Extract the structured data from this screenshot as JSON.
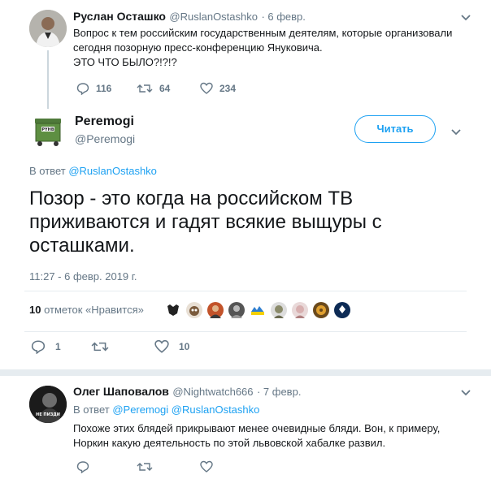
{
  "tweet1": {
    "author_name": "Руслан Осташко",
    "author_handle": "@RuslanOstashko",
    "date": "· 6 февр.",
    "text_line1": "Вопрос к тем российским государственным деятелям, которые организовали",
    "text_line2": "сегодня позорную пресс-конференцию Януковича.",
    "text_line3": "ЭТО ЧТО БЫЛО?!?!?",
    "replies": "116",
    "retweets": "64",
    "likes": "234"
  },
  "main_tweet": {
    "author_name": "Peremogi",
    "author_handle": "@Peremogi",
    "follow_label": "Читать",
    "reply_prefix": "В ответ",
    "reply_to": "@RuslanOstashko",
    "text": "Позор - это когда на российском ТВ приживаются и гадят всякие выщуры с осташками.",
    "timestamp": "11:27 - 6 февр. 2019 г.",
    "likes_count": "10",
    "likes_label": "отметок «Нравится»",
    "replies": "1",
    "retweets": "",
    "likes": "10",
    "avatar_label": "РУНВ"
  },
  "tweet3": {
    "author_name": "Олег Шаповалов",
    "author_handle": "@Nightwatch666",
    "date": "· 7 февр.",
    "reply_prefix": "В ответ",
    "reply_to_1": "@Peremogi",
    "reply_to_2": "@RuslanOstashko",
    "text_line1": "Похоже этих блядей прикрывают менее очевидные бляди. Вон, к примеру,",
    "text_line2": "Норкин какую деятельность по этой львовской хабалке развил.",
    "avatar_label": "НЕ ПИЗДИ"
  },
  "colors": {
    "accent": "#1da1f2",
    "gray": "#657786",
    "divider": "#e6ecf0"
  }
}
